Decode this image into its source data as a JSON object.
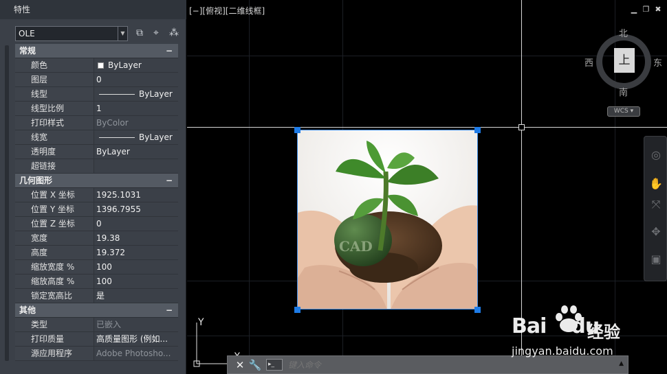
{
  "panel": {
    "title": "特性",
    "selector_value": "OLE",
    "sections": [
      {
        "title": "常规",
        "collapse": "−",
        "rows": [
          {
            "key": "颜色",
            "value": "ByLayer",
            "swatch": "#ffffff"
          },
          {
            "key": "图层",
            "value": "0"
          },
          {
            "key": "线型",
            "value": "ByLayer",
            "line": true
          },
          {
            "key": "线型比例",
            "value": "1"
          },
          {
            "key": "打印样式",
            "value": "ByColor",
            "dim": true
          },
          {
            "key": "线宽",
            "value": "ByLayer",
            "line": true
          },
          {
            "key": "透明度",
            "value": "ByLayer"
          },
          {
            "key": "超链接",
            "value": ""
          }
        ]
      },
      {
        "title": "几何图形",
        "collapse": "−",
        "rows": [
          {
            "key": "位置 X 坐标",
            "value": "1925.1031"
          },
          {
            "key": "位置 Y 坐标",
            "value": "1396.7955"
          },
          {
            "key": "位置 Z 坐标",
            "value": "0"
          },
          {
            "key": "宽度",
            "value": "19.38"
          },
          {
            "key": "高度",
            "value": "19.372"
          },
          {
            "key": "缩放宽度 %",
            "value": "100"
          },
          {
            "key": "缩放高度 %",
            "value": "100"
          },
          {
            "key": "锁定宽高比",
            "value": "是"
          }
        ]
      },
      {
        "title": "其他",
        "collapse": "−",
        "rows": [
          {
            "key": "类型",
            "value": "已嵌入",
            "dim": true
          },
          {
            "key": "打印质量",
            "value": "高质量图形 (例如..."
          },
          {
            "key": "源应用程序",
            "value": "Adobe Photosho...",
            "dim": true
          }
        ]
      }
    ]
  },
  "viewport": {
    "title": "[−][俯视][二维线框]",
    "viewcube": {
      "face": "上",
      "north": "北",
      "south": "南",
      "east": "东",
      "west": "西",
      "wcs": "WCS"
    },
    "ucs": {
      "y": "Y",
      "x": "X"
    },
    "ole_image_text": "CAD"
  },
  "command": {
    "placeholder": "键入命令"
  },
  "watermark": {
    "brand": "Bai",
    "brand2": "du",
    "site": "经验",
    "url": "jingyan.baidu.com"
  }
}
